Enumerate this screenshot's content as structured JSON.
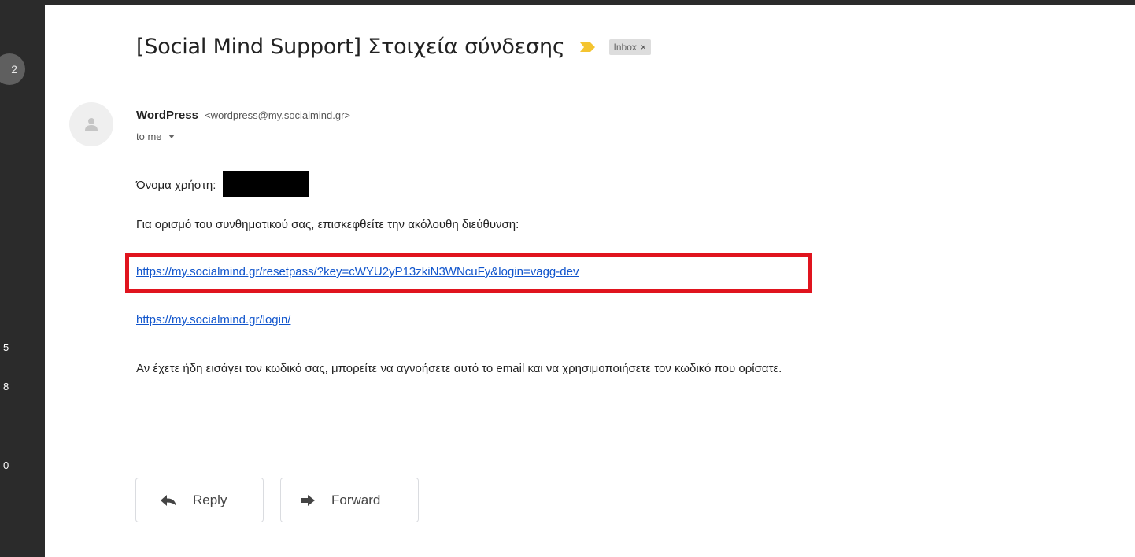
{
  "left_strip": {
    "badge": "2",
    "numbers": [
      "5",
      "8",
      "0"
    ]
  },
  "email": {
    "subject": "[Social Mind Support] Στοιχεία σύνδεσης",
    "label": "Inbox",
    "label_close": "×",
    "sender_name": "WordPress",
    "sender_email": "<wordpress@my.socialmind.gr>",
    "recipient": "to me",
    "username_label": "Όνομα χρήστη:",
    "instructions": "Για ορισμό του συνθηματικού σας, επισκεφθείτε την ακόλουθη διεύθυνση:",
    "reset_link": "https://my.socialmind.gr/resetpass/?key=cWYU2yP13zkiN3WNcuFy&login=vagg-dev",
    "login_link": "https://my.socialmind.gr/login/",
    "footer_note": "Αν έχετε ήδη εισάγει τον κωδικό σας, μπορείτε να αγνοήσετε αυτό το email και να χρησιμοποιήσετε τον κωδικό που ορίσατε."
  },
  "actions": {
    "reply_label": "Reply",
    "forward_label": "Forward"
  },
  "colors": {
    "importance": "#f4c430",
    "link": "#1155cc",
    "highlight": "#e0141e"
  }
}
